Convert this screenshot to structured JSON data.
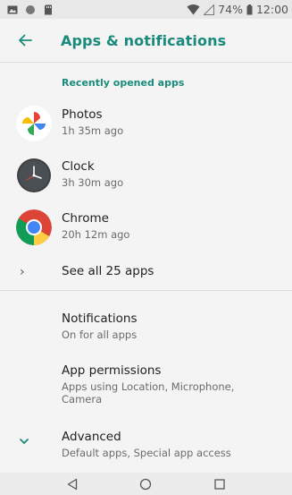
{
  "status_bar": {
    "battery_percent": "74%",
    "time": "12:00",
    "icons": [
      "image-notification-icon",
      "circle-notification-icon",
      "sd-card-icon",
      "wifi-icon",
      "signal-icon",
      "battery-icon"
    ]
  },
  "app_bar": {
    "title": "Apps & notifications",
    "accent_color": "#1a8a7c"
  },
  "recent": {
    "header": "Recently opened apps",
    "apps": [
      {
        "name": "Photos",
        "time": "1h 35m ago",
        "icon": "photos-icon"
      },
      {
        "name": "Clock",
        "time": "3h 30m ago",
        "icon": "clock-icon"
      },
      {
        "name": "Chrome",
        "time": "20h 12m ago",
        "icon": "chrome-icon"
      }
    ],
    "see_all": "See all 25 apps"
  },
  "settings": {
    "notifications": {
      "title": "Notifications",
      "summary": "On for all apps"
    },
    "permissions": {
      "title": "App permissions",
      "summary_line1": "Apps using Location, Microphone,",
      "summary_line2": "Camera"
    },
    "advanced": {
      "title": "Advanced",
      "summary": "Default apps, Special app access"
    }
  },
  "nav_bar": {
    "icons": [
      "back-icon",
      "home-icon",
      "recents-icon"
    ]
  }
}
